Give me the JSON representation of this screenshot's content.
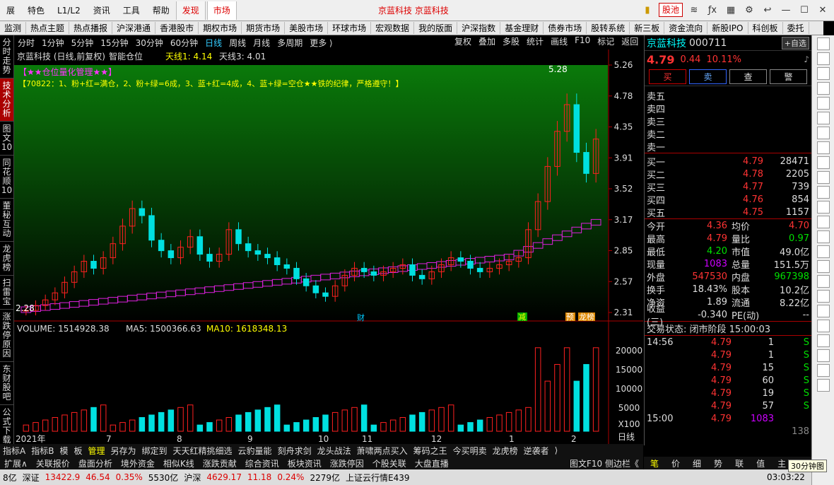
{
  "menu": {
    "items": [
      "展",
      "特色",
      "L1/L2",
      "资讯",
      "工具",
      "帮助"
    ],
    "tab_discover": "发现",
    "tab_market": "市场",
    "app_title": "京蓝科技 京蓝科技",
    "stock_pool": "股池"
  },
  "nav": [
    "监测",
    "热点主题",
    "热点播报",
    "沪深港通",
    "香港股市",
    "期权市场",
    "期货市场",
    "美股市场",
    "环球市场",
    "宏观数据",
    "我的版面",
    "沪深指数",
    "基金理财",
    "债券市场",
    "股转系统",
    "新三板",
    "资金流向",
    "新股IPO",
    "科创板",
    "委托"
  ],
  "leftbar": [
    "分时走势",
    "技术分析",
    "图文10",
    "同花顺10",
    "董秘互动",
    "龙虎榜",
    "扫雷宝",
    "涨跌停原因",
    "东财股吧",
    "公式下载"
  ],
  "toolbar": {
    "periods": [
      "分时",
      "1分钟",
      "5分钟",
      "15分钟",
      "30分钟",
      "60分钟",
      "日线",
      "周线",
      "月线",
      "多周期",
      "更多 ⟩"
    ],
    "selected": "日线",
    "right": [
      "复权",
      "叠加",
      "多股",
      "统计",
      "画线",
      "F10",
      "标记",
      "返回"
    ]
  },
  "chart": {
    "header_name": "京蓝科技 (日线,前复权)",
    "smart": "智能仓位",
    "tl1": "天线1: 4.14",
    "tl3": "天线3: 4.01",
    "tag1": "【★★仓位量化管理★★】",
    "tag2": "【70822：1、粉+红=满仓，2、粉+绿=6成，3、蓝+红=4成，4、蓝+绿=空仓★★铁的纪律，严格遵守！】",
    "high_label": "5.28",
    "low_label": "2.28",
    "price_ticks": [
      "5.26",
      "4.78",
      "4.35",
      "3.91",
      "3.52",
      "3.17",
      "2.85",
      "2.57",
      "2.31"
    ],
    "vol_ticks": [
      "20000",
      "15000",
      "10000",
      "5000",
      "X100"
    ],
    "vol_header": "VOLUME: 1514928.38",
    "ma5": "MA5: 1500366.63",
    "ma10": "MA10: 1618348.13",
    "date_labels": [
      "2021年",
      "7",
      "8",
      "9",
      "10",
      "11",
      "12",
      "1",
      "2"
    ],
    "period_label": "日线",
    "marks": {
      "cai": "财",
      "jian": "减",
      "yu": "预",
      "list": "龙榜"
    },
    "colors": {
      "up": "#ff2020",
      "down": "#00e0e0",
      "ma5": "#ffffff",
      "ma10": "#ffff00",
      "band_red": "#ff3030",
      "band_green": "#30ff30",
      "band_purple": "#e020e0",
      "band_blue": "#2040ff"
    }
  },
  "chart_data": {
    "type": "candlestick",
    "title": "京蓝科技 (日线,前复权)",
    "y_range": [
      2.28,
      5.28
    ],
    "volume_range": [
      0,
      22000
    ],
    "candles_approx_close": [
      2.35,
      2.42,
      2.5,
      2.6,
      2.75,
      2.9,
      3.05,
      2.95,
      3.1,
      3.3,
      3.55,
      3.8,
      3.7,
      3.35,
      3.2,
      3.1,
      3.25,
      3.4,
      3.15,
      3.05,
      3.15,
      3.5,
      3.3,
      3.2,
      3.15,
      3.1,
      3.0,
      2.95,
      2.8,
      2.7,
      2.6,
      2.55,
      2.7,
      2.85,
      2.95,
      2.9,
      2.85,
      2.9,
      2.95,
      3.0,
      2.85,
      2.8,
      2.9,
      3.0,
      3.1,
      3.05,
      2.95,
      2.9,
      2.95,
      3.0,
      3.05,
      3.1,
      3.5,
      3.9,
      4.4,
      4.9,
      5.28,
      4.6,
      4.3,
      4.79
    ]
  },
  "quote": {
    "name": "京蓝科技",
    "code": "000711",
    "price": "4.79",
    "change": "0.44",
    "pct": "10.11%",
    "btn_buy": "买",
    "btn_sell": "卖",
    "btn_check": "查",
    "btn_alert": "警",
    "custom": "+自选",
    "sells": [
      {
        "label": "卖五",
        "price": "",
        "vol": ""
      },
      {
        "label": "卖四",
        "price": "",
        "vol": ""
      },
      {
        "label": "卖三",
        "price": "",
        "vol": ""
      },
      {
        "label": "卖二",
        "price": "",
        "vol": ""
      },
      {
        "label": "卖一",
        "price": "",
        "vol": ""
      }
    ],
    "buys": [
      {
        "label": "买一",
        "price": "4.79",
        "vol": "28471"
      },
      {
        "label": "买二",
        "price": "4.78",
        "vol": "2205"
      },
      {
        "label": "买三",
        "price": "4.77",
        "vol": "739"
      },
      {
        "label": "买四",
        "price": "4.76",
        "vol": "854"
      },
      {
        "label": "买五",
        "price": "4.75",
        "vol": "1157"
      }
    ],
    "stats": [
      {
        "l": "今开",
        "m": "4.36",
        "c": "red",
        "r": "均价",
        "v": "4.70",
        "vc": "red"
      },
      {
        "l": "最高",
        "m": "4.79",
        "c": "red",
        "r": "量比",
        "v": "0.97",
        "vc": "green"
      },
      {
        "l": "最低",
        "m": "4.20",
        "c": "green",
        "r": "市值",
        "v": "49.0亿",
        "vc": ""
      },
      {
        "l": "现量",
        "m": "1083",
        "c": "purple",
        "r": "总量",
        "v": "151.5万",
        "vc": ""
      },
      {
        "l": "外盘",
        "m": "547530",
        "c": "red",
        "r": "内盘",
        "v": "967398",
        "vc": "green"
      },
      {
        "l": "换手",
        "m": "18.43%",
        "c": "",
        "r": "股本",
        "v": "10.2亿",
        "vc": ""
      },
      {
        "l": "净资",
        "m": "1.89",
        "c": "",
        "r": "流通",
        "v": "8.22亿",
        "vc": ""
      },
      {
        "l": "收益(三)",
        "m": "-0.340",
        "c": "",
        "r": "PE(动)",
        "v": "--",
        "vc": ""
      }
    ],
    "trade_state": "交易状态: 闭市阶段 15:00:03",
    "ticks": [
      {
        "t": "14:56",
        "p": "4.79",
        "v": "1",
        "d": "S"
      },
      {
        "t": "",
        "p": "4.79",
        "v": "1",
        "d": "S"
      },
      {
        "t": "",
        "p": "4.79",
        "v": "15",
        "d": "S"
      },
      {
        "t": "",
        "p": "4.79",
        "v": "60",
        "d": "S"
      },
      {
        "t": "",
        "p": "4.79",
        "v": "19",
        "d": "S"
      },
      {
        "t": "",
        "p": "4.79",
        "v": "57",
        "d": "S"
      },
      {
        "t": "15:00",
        "p": "4.79",
        "v": "1083",
        "d": ""
      }
    ],
    "tick_last_extra": "138",
    "tabs": [
      "笔",
      "价",
      "细",
      "势",
      "联",
      "值",
      "主"
    ]
  },
  "bottom": {
    "tabs1": [
      "指标A",
      "指标B",
      "模",
      "板",
      "管理",
      "另存为",
      "绑定到",
      "天天红精挑细选",
      "云豹量能",
      "刻舟求剑",
      "龙头战法",
      "萧啸两点买入",
      "筹码之王",
      "今买明卖",
      "龙虎榜",
      "逆袭者",
      "⟩"
    ],
    "tabs1_sel": "管理",
    "tabs2": [
      "扩展∧",
      "关联报价",
      "盘面分析",
      "境外资金",
      "相似K线",
      "涨跌贡献",
      "综合资讯",
      "板块资讯",
      "涨跌停因",
      "个股关联",
      "大盘直播"
    ],
    "tabs2_right": "图文F10  侧边栏《",
    "status": [
      {
        "t": "8亿",
        "c": ""
      },
      {
        "t": "深证",
        "c": ""
      },
      {
        "t": "13422.9",
        "c": "red"
      },
      {
        "t": "46.54",
        "c": "red"
      },
      {
        "t": "0.35%",
        "c": "red"
      },
      {
        "t": "5530亿",
        "c": ""
      },
      {
        "t": "沪深",
        "c": ""
      },
      {
        "t": "4629.17",
        "c": "red"
      },
      {
        "t": "11.18",
        "c": "red"
      },
      {
        "t": "0.24%",
        "c": "red"
      },
      {
        "t": "2279亿",
        "c": ""
      },
      {
        "t": "上证云行情E439",
        "c": ""
      }
    ],
    "clock": "03:03:22",
    "tooltip": "30分钟图"
  }
}
